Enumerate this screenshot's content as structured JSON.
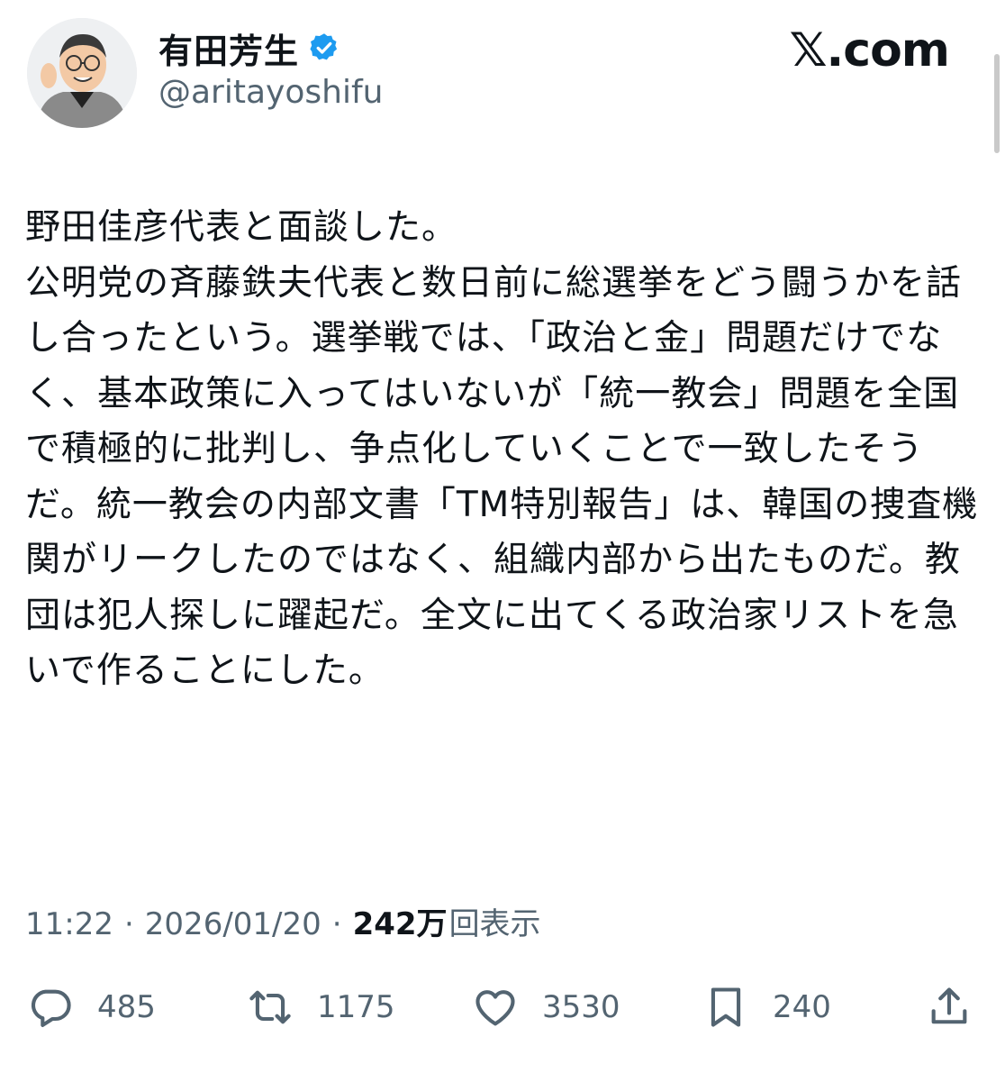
{
  "author": {
    "display_name": "有田芳生",
    "handle": "@aritayoshifu",
    "verified": true,
    "avatar_icon": "cartoon-avatar-icon"
  },
  "brand": {
    "logo_text": "𝕏.com"
  },
  "tweet": {
    "text": "野田佳彦代表と面談した。\n公明党の斉藤鉄夫代表と数日前に総選挙をどう闘うかを話し合ったという。選挙戦では、「政治と金」問題だけでなく、基本政策に入ってはいないが「統一教会」問題を全国で積極的に批判し、争点化していくことで一致したそうだ。統一教会の内部文書「TM特別報告」は、韓国の捜査機関がリークしたのではなく、組織内部から出たものだ。教団は犯人探しに躍起だ。全文に出てくる政治家リストを急いで作ることにした。",
    "time": "11:22",
    "date": "2026/01/20",
    "separator": "·",
    "views_count": "242万",
    "views_label": "回表示"
  },
  "actions": {
    "replies": "485",
    "retweets": "1175",
    "likes": "3530",
    "bookmarks": "240"
  },
  "colors": {
    "text": "#0f1419",
    "secondary": "#536471",
    "verified": "#1d9bf0"
  }
}
